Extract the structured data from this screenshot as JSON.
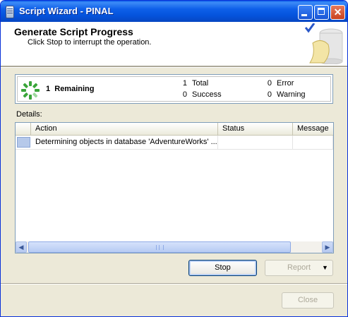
{
  "window": {
    "title": "Script Wizard - PINAL"
  },
  "header": {
    "title": "Generate Script Progress",
    "subtitle": "Click Stop to interrupt the operation."
  },
  "summary": {
    "remaining_count": "1",
    "remaining_label": "Remaining",
    "total_count": "1",
    "total_label": "Total",
    "success_count": "0",
    "success_label": "Success",
    "error_count": "0",
    "error_label": "Error",
    "warning_count": "0",
    "warning_label": "Warning"
  },
  "details": {
    "label": "Details:",
    "columns": [
      "Action",
      "Status",
      "Message"
    ],
    "rows": [
      {
        "action": "Determining objects in database 'AdventureWorks' ...",
        "status": "",
        "message": ""
      }
    ]
  },
  "buttons": {
    "stop": "Stop",
    "report": "Report",
    "close": "Close"
  },
  "colors": {
    "titlebar": "#0553dc",
    "spinner": "#3aa53a",
    "selection": "#b6c9ea"
  }
}
